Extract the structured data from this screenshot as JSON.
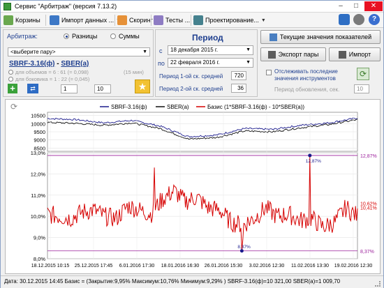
{
  "window": {
    "title": "Сервис \"Арбитраж\" (версия 7.13.2)"
  },
  "toolbar": {
    "baskets": "Корзины",
    "import_data": "Импорт данных ...",
    "scoring": "Скоринг",
    "tests": "Тесты ...",
    "design": "Проектирование..."
  },
  "arbitrage": {
    "label": "Арбитраж:",
    "mode_diff": "Разницы",
    "mode_sum": "Суммы",
    "pair_placeholder": "<выберите пару>",
    "leg1": "SBRF-3.16(ф)",
    "dash": "-",
    "leg2": "SBER(а)",
    "vol_text": "для объемов = 6 : 61 (= 0,098)",
    "side_text": "для боковика = 1 : 22 (= 0,045)",
    "interval": "(15 мин)",
    "ratio_left": "1",
    "ratio_right": "10"
  },
  "period": {
    "title": "Период",
    "from_label": "с",
    "from_date": "18 декабря 2015 г.",
    "to_label": "по",
    "to_date": "22 февраля 2016 г.",
    "ma1_label": "Период 1-ой ск. средней",
    "ma1_value": "720",
    "ma2_label": "Период 2-ой ск. средней",
    "ma2_value": "36"
  },
  "actions": {
    "current_values": "Текущие значения показателей",
    "export_pair": "Экспорт пары",
    "import": "Импорт",
    "track_label_1": "Отслеживать последние",
    "track_label_2": "значения инструментов",
    "refresh_label": "Период обновления, сек.",
    "refresh_value": "10"
  },
  "status": {
    "text": "Дата: 30.12.2015 14:45  Базис = (Закрытие:9,95%  Максимум:10,76%  Минимум:9,29% )  SBRF-3.16(ф)=10 321,00  SBER(а)=1 009,70"
  },
  "colors": {
    "series1": "#1a1a8c",
    "series2": "#111111",
    "basis": "#d60000",
    "marker": "#9b1f9b"
  },
  "chart_data": [
    {
      "type": "line",
      "legend": [
        "SBRF-3.16(ф)",
        "SBER(а)",
        "Базис (1*SBRF-3.16(ф) - 10*SBER(а))"
      ],
      "yticks": [
        "10500",
        "10000",
        "9500",
        "9000",
        "8500"
      ],
      "ylim": [
        8300,
        10700
      ],
      "series": [
        {
          "name": "SBRF-3.16(ф)",
          "values": [
            10320,
            10250,
            10050,
            10200,
            9850,
            9200,
            9300,
            9700,
            9650,
            9900,
            10050,
            10350
          ]
        },
        {
          "name": "SBER(а)",
          "values": [
            10080,
            10020,
            9900,
            10050,
            9700,
            9050,
            9150,
            9550,
            9500,
            9750,
            9950,
            10250
          ]
        }
      ]
    },
    {
      "type": "line",
      "x_ticks": [
        "18.12.2015 10:15",
        "25.12.2015 17:45",
        "6.01.2016 17:30",
        "18.01.2016 16:30",
        "26.01.2016 15:30",
        "3.02.2016 12:30",
        "11.02.2016 13:30",
        "19.02.2016 12:30"
      ],
      "yticks": [
        "13,0%",
        "12,0%",
        "11,0%",
        "10,0%",
        "9,0%",
        "8,0%"
      ],
      "ylim": [
        8.0,
        13.0
      ],
      "series": [
        {
          "name": "Базис (1*SBRF-3.16(ф) - 10*SBER(а))",
          "values": [
            10.1,
            10.0,
            9.9,
            10.2,
            10.3,
            10.0,
            9.9,
            10.5,
            10.3,
            10.1,
            10.8,
            11.2,
            10.7,
            10.9,
            10.4,
            10.3,
            9.7,
            9.6,
            9.9,
            10.4,
            10.0,
            10.1,
            9.8,
            9.9,
            9.5,
            9.7,
            10.4,
            10.0
          ]
        }
      ],
      "annotations": [
        {
          "label": "12,87%",
          "value": 12.87
        },
        {
          "label": "8,37%",
          "value": 8.37
        },
        {
          "label": "10,62%",
          "value": 10.62
        },
        {
          "label": "10,41%",
          "value": 10.41
        }
      ]
    }
  ]
}
